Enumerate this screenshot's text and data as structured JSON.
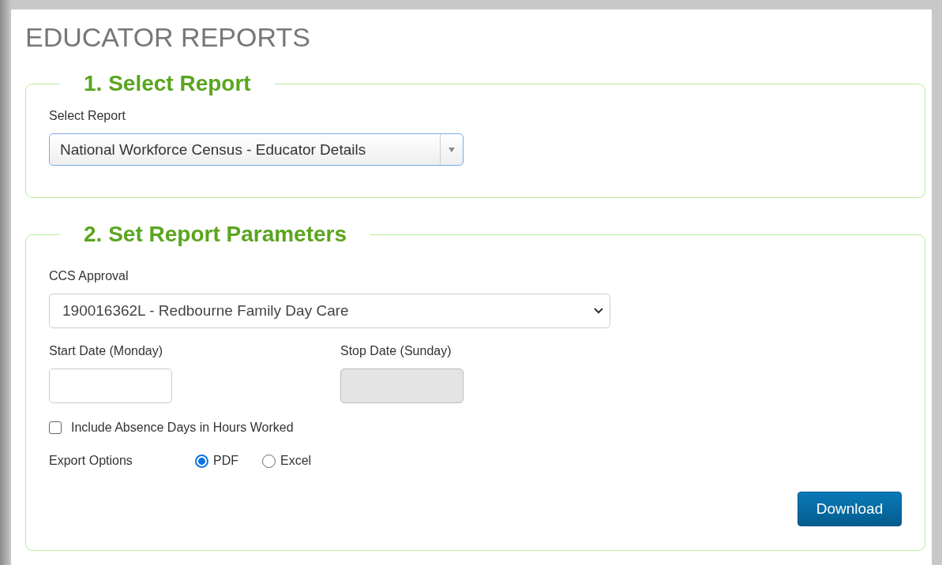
{
  "page_title": "EDUCATOR REPORTS",
  "sections": [
    {
      "legend": "1. Select Report",
      "fields": [
        {
          "kind": "combo",
          "label": "Select Report",
          "value": "National Workforce Census - Educator Details"
        }
      ]
    },
    {
      "legend": "2. Set Report Parameters",
      "fields": [
        {
          "kind": "select",
          "label": "CCS Approval",
          "value": "190016362L - Redbourne Family Day Care"
        },
        {
          "kind": "dates",
          "items": [
            {
              "label": "Start Date (Monday)",
              "disabled": false
            },
            {
              "label": "Stop Date (Sunday)",
              "disabled": true
            }
          ]
        },
        {
          "kind": "checkbox",
          "label": "Include Absence Days in Hours Worked",
          "checked": false
        },
        {
          "kind": "radios",
          "label": "Export Options",
          "options": [
            {
              "label": "PDF",
              "selected": true
            },
            {
              "label": "Excel",
              "selected": false
            }
          ]
        },
        {
          "kind": "button",
          "label": "Download"
        }
      ]
    }
  ]
}
